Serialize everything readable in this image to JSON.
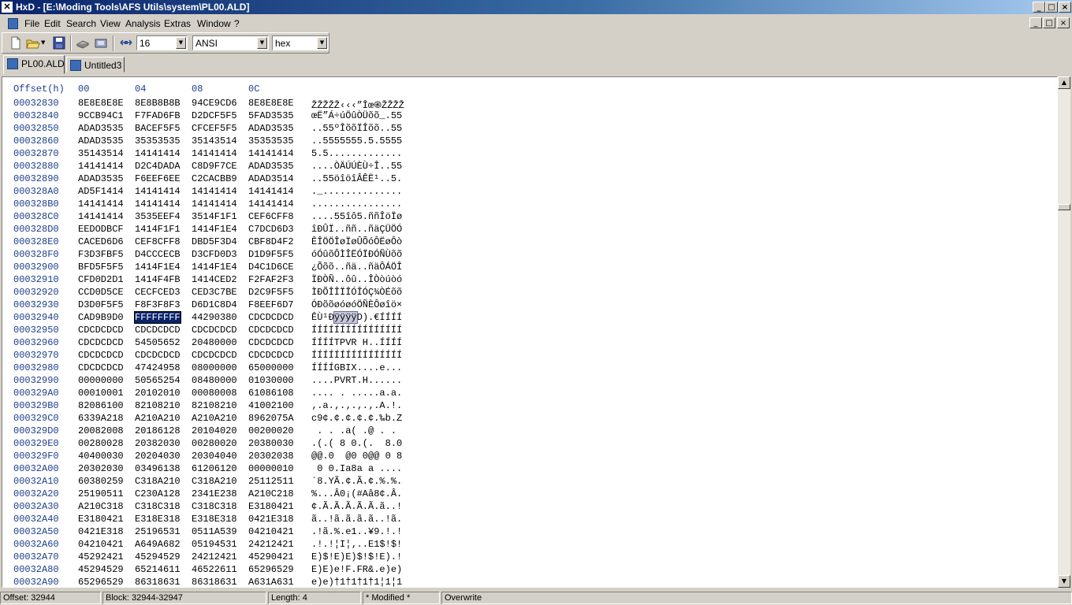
{
  "window": {
    "app_icon": "hxd-icon",
    "title": "HxD - [E:\\Moding Tools\\AFS Utils\\system\\PL00.ALD]",
    "buttons": {
      "minimize": "_",
      "maximize": "□",
      "close": "×"
    }
  },
  "menu": {
    "items": [
      "File",
      "Edit",
      "Search",
      "View",
      "Analysis",
      "Extras",
      "Window",
      "?"
    ]
  },
  "toolbar": {
    "bytes_per_row": "16",
    "charset": "ANSI",
    "offset_base": "hex"
  },
  "tabs": [
    {
      "label": "PL00.ALD",
      "active": true
    },
    {
      "label": "Untitled3",
      "active": false
    }
  ],
  "hex_view": {
    "header": {
      "offset": "Offset(h)",
      "cols": [
        "00",
        "04",
        "08",
        "0C"
      ]
    },
    "selected_offset": "00032944",
    "rows": [
      {
        "offset": "00032830",
        "groups": [
          "8E8E8E8E",
          "8E8B8B8B",
          "94CE9CD6",
          "8E8E8E8E"
        ],
        "ascii": "ŽŽŽŽŽ‹‹‹”Îœ֎ŽŽŽŽ"
      },
      {
        "offset": "00032840",
        "groups": [
          "9CCB94C1",
          "F7FAD6FB",
          "D2DCF5F5",
          "5FAD3535"
        ],
        "ascii": "œË”Á÷úÖûÒÜõõ_.55"
      },
      {
        "offset": "00032850",
        "groups": [
          "ADAD3535",
          "BACEF5F5",
          "CFCEF5F5",
          "ADAD3535"
        ],
        "ascii": "..55ºÎõõÏÎõõ..55"
      },
      {
        "offset": "00032860",
        "groups": [
          "ADAD3535",
          "35353535",
          "35143514",
          "35353535"
        ],
        "ascii": "..5555555.5.5555"
      },
      {
        "offset": "00032870",
        "groups": [
          "35143514",
          "14141414",
          "14141414",
          "14141414"
        ],
        "ascii": "5.5............."
      },
      {
        "offset": "00032880",
        "groups": [
          "14141414",
          "D2C4DADA",
          "C8D9F7CE",
          "ADAD3535"
        ],
        "ascii": "....ÒÄÚÚÈÙ÷Î..55"
      },
      {
        "offset": "00032890",
        "groups": [
          "ADAD3535",
          "F6EEF6EE",
          "C2CACBB9",
          "ADAD3514"
        ],
        "ascii": "..55öîöîÂÊË¹..5."
      },
      {
        "offset": "000328A0",
        "groups": [
          "AD5F1414",
          "14141414",
          "14141414",
          "14141414"
        ],
        "ascii": "._.............."
      },
      {
        "offset": "000328B0",
        "groups": [
          "14141414",
          "14141414",
          "14141414",
          "14141414"
        ],
        "ascii": "................"
      },
      {
        "offset": "000328C0",
        "groups": [
          "14141414",
          "3535EEF4",
          "3514F1F1",
          "CEF6CFF8"
        ],
        "ascii": "....55îô5.ññÎöÏø"
      },
      {
        "offset": "000328D0",
        "groups": [
          "EEDODBCF",
          "1414F1F1",
          "1414F1E4",
          "C7DCD6D3"
        ],
        "ascii": "îÐÛÏ..ññ..ñäÇÜÖÓ"
      },
      {
        "offset": "000328E0",
        "groups": [
          "CACED6D6",
          "CEF8CFF8",
          "DBD5F3D4",
          "CBF8D4F2"
        ],
        "ascii": "ÊÎÖÖÎøÏøÛÕóÔËøÔò"
      },
      {
        "offset": "000328F0",
        "groups": [
          "F3D3FBF5",
          "D4CCCECB",
          "D3CFD0D3",
          "D1D9F5F5"
        ],
        "ascii": "óÓûõÔÌÎËÓÏÐÓÑÙõõ"
      },
      {
        "offset": "00032900",
        "groups": [
          "BFD5F5F5",
          "1414F1E4",
          "1414F1E4",
          "D4C1D6CE"
        ],
        "ascii": "¿Õõõ..ñä..ñäÔÁÖÎ"
      },
      {
        "offset": "00032910",
        "groups": [
          "CFD0D2D1",
          "1414F4FB",
          "1414CED2",
          "F2FAF2F3"
        ],
        "ascii": "ÏÐÒÑ..ôû..ÎÒòúòó"
      },
      {
        "offset": "00032920",
        "groups": [
          "CCD0D5CE",
          "CECFCED3",
          "CED3C7BE",
          "D2C9F5F5"
        ],
        "ascii": "ÌÐÕÎÎÏÎÓÎÓÇ¾ÒÉõõ"
      },
      {
        "offset": "00032930",
        "groups": [
          "D3D0F5F5",
          "F8F3F8F3",
          "D6D1C8D4",
          "F8EEF6D7"
        ],
        "ascii": "ÓÐõõøóøóÖÑÈÔøîö×"
      },
      {
        "offset": "00032940",
        "groups": [
          "CAD9B9D0",
          "FFFFFFFF",
          "44290380",
          "CDCDCDCD"
        ],
        "ascii_pre": "ÊÙ¹Ð",
        "ascii_sel": "ÿÿÿÿ",
        "ascii_post": "D).€ÍÍÍÍ",
        "selected_group": 1
      },
      {
        "offset": "00032950",
        "groups": [
          "CDCDCDCD",
          "CDCDCDCD",
          "CDCDCDCD",
          "CDCDCDCD"
        ],
        "ascii": "ÍÍÍÍÍÍÍÍÍÍÍÍÍÍÍÍ"
      },
      {
        "offset": "00032960",
        "groups": [
          "CDCDCDCD",
          "54505652",
          "20480000",
          "CDCDCDCD"
        ],
        "ascii": "ÍÍÍÍTPVR H..ÍÍÍÍ"
      },
      {
        "offset": "00032970",
        "groups": [
          "CDCDCDCD",
          "CDCDCDCD",
          "CDCDCDCD",
          "CDCDCDCD"
        ],
        "ascii": "ÍÍÍÍÍÍÍÍÍÍÍÍÍÍÍÍ"
      },
      {
        "offset": "00032980",
        "groups": [
          "CDCDCDCD",
          "47424958",
          "08000000",
          "65000000"
        ],
        "ascii": "ÍÍÍÍGBIX....e..."
      },
      {
        "offset": "00032990",
        "groups": [
          "00000000",
          "50565254",
          "08480000",
          "01030000"
        ],
        "ascii": "....PVRT.H......"
      },
      {
        "offset": "000329A0",
        "groups": [
          "00010001",
          "20102010",
          "00080008",
          "61086108"
        ],
        "ascii": ".... . .....a.a."
      },
      {
        "offset": "000329B0",
        "groups": [
          "82086100",
          "82108210",
          "82108210",
          "41002100"
        ],
        "ascii": "‚.a.‚.‚.‚.‚.A.!."
      },
      {
        "offset": "000329C0",
        "groups": [
          "6339A218",
          "A210A210",
          "A210A210",
          "8962075A"
        ],
        "ascii": "c9¢.¢.¢.¢.¢.‰b.Z"
      },
      {
        "offset": "000329D0",
        "groups": [
          "20082008",
          "20186128",
          "20104020",
          "00200020"
        ],
        "ascii": " . . .a( .@ . . "
      },
      {
        "offset": "000329E0",
        "groups": [
          "00280028",
          "20382030",
          "00280020",
          "20380030"
        ],
        "ascii": ".(.( 8 0.(.  8.0"
      },
      {
        "offset": "000329F0",
        "groups": [
          "40400030",
          "20204030",
          "20304040",
          "20302038"
        ],
        "ascii": "@@.0  @0 0@@ 0 8"
      },
      {
        "offset": "00032A00",
        "groups": [
          "20302030",
          "03496138",
          "61206120",
          "00000010"
        ],
        "ascii": " 0 0.Ia8a a ...."
      },
      {
        "offset": "00032A10",
        "groups": [
          "60380259",
          "C318A210",
          "C318A210",
          "25112511"
        ],
        "ascii": "`8.YÃ.¢.Ã.¢.%.%."
      },
      {
        "offset": "00032A20",
        "groups": [
          "25190511",
          "C230A128",
          "2341E238",
          "A210C218"
        ],
        "ascii": "%...Â0¡(#Aâ8¢.Â."
      },
      {
        "offset": "00032A30",
        "groups": [
          "A210C318",
          "C318C318",
          "C318C318",
          "E3180421"
        ],
        "ascii": "¢.Ã.Ã.Ã.Ã.Ã.ã..!"
      },
      {
        "offset": "00032A40",
        "groups": [
          "E3180421",
          "E318E318",
          "E318E318",
          "0421E318"
        ],
        "ascii": "ã..!ã.ã.ã.ã..!ã."
      },
      {
        "offset": "00032A50",
        "groups": [
          "0421E318",
          "25196531",
          "0511A539",
          "04210421"
        ],
        "ascii": ".!ã.%.e1..¥9.!.!"
      },
      {
        "offset": "00032A60",
        "groups": [
          "04210421",
          "A649A682",
          "05194531",
          "24212421"
        ],
        "ascii": ".!.!¦I¦‚..E1$!$!"
      },
      {
        "offset": "00032A70",
        "groups": [
          "45292421",
          "45294529",
          "24212421",
          "45290421"
        ],
        "ascii": "E)$!E)E)$!$!E).!"
      },
      {
        "offset": "00032A80",
        "groups": [
          "45294529",
          "65214611",
          "46522611",
          "65296529"
        ],
        "ascii": "E)E)e!F.FR&.e)e)"
      },
      {
        "offset": "00032A90",
        "groups": [
          "65296529",
          "86318631",
          "86318631",
          "A631A631"
        ],
        "ascii": "e)e)†1†1†1†1¦1¦1"
      }
    ]
  },
  "scrollbar": {
    "position_fraction": 0.24
  },
  "statusbar": {
    "offset": "Offset: 32944",
    "block": "Block: 32944-32947",
    "length": "Length: 4",
    "modified": "* Modified *",
    "mode": "Overwrite"
  }
}
